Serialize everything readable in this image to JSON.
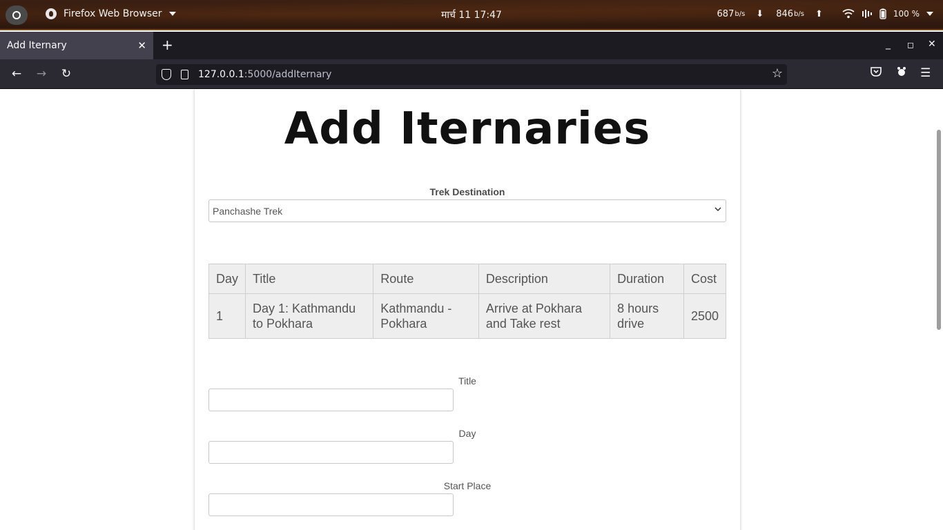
{
  "os": {
    "app_name": "Firefox Web Browser",
    "clock": "मार्च 11  17:47",
    "net_down": "687",
    "net_down_unit": "b/s",
    "net_up": "846",
    "net_up_unit": "b/s",
    "battery": "100 %"
  },
  "browser": {
    "tab_title": "Add Iternary",
    "url_host": "127.0.0.1",
    "url_rest": ":5000/addIternary"
  },
  "page": {
    "title": "Add Iternaries",
    "destination_label": "Trek Destination",
    "destination_selected": "Panchashe Trek",
    "table": {
      "headers": [
        "Day",
        "Title",
        "Route",
        "Description",
        "Duration",
        "Cost"
      ],
      "rows": [
        [
          "1",
          "Day 1: Kathmandu to Pokhara",
          "Kathmandu - Pokhara",
          "Arrive at Pokhara and Take rest",
          "8 hours drive",
          "2500"
        ]
      ]
    },
    "form": {
      "title_label": "Title",
      "day_label": "Day",
      "start_place_label": "Start Place"
    }
  }
}
